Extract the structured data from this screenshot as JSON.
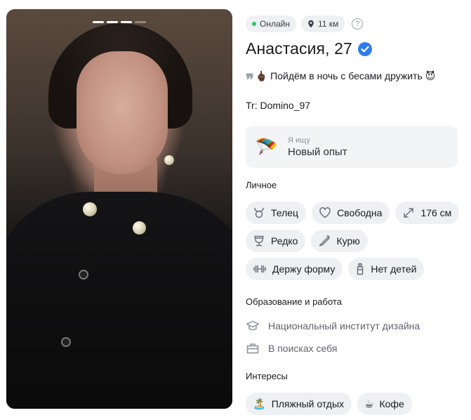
{
  "photo": {
    "pages_total": 4,
    "current_page": 3
  },
  "status": {
    "online_label": "Онлайн",
    "distance": "11 км"
  },
  "profile": {
    "name_age": "Анастасия, 27",
    "verified": true,
    "bio_line1": "🖕🏿 Пойдём в ночь с бесами дружить 😈",
    "bio_line2": "Tr: Domino_97"
  },
  "looking_for": {
    "label": "Я ищу",
    "value": "Новый опыт",
    "icon": "parachute-emoji"
  },
  "personal": {
    "title": "Личное",
    "chips": [
      {
        "icon": "taurus-icon",
        "label": "Телец"
      },
      {
        "icon": "heart-icon",
        "label": "Свободна"
      },
      {
        "icon": "height-icon",
        "label": "176 см"
      },
      {
        "icon": "drink-icon",
        "label": "Редко"
      },
      {
        "icon": "smoking-icon",
        "label": "Курю"
      },
      {
        "icon": "dumbbell-icon",
        "label": "Держу форму"
      },
      {
        "icon": "baby-bottle-icon",
        "label": "Нет детей"
      }
    ]
  },
  "education": {
    "title": "Образование и работа",
    "items": [
      {
        "icon": "graduation-cap-icon",
        "label": "Национальный институт дизайна"
      },
      {
        "icon": "briefcase-icon",
        "label": "В поисках себя"
      }
    ]
  },
  "interests": {
    "title": "Интересы",
    "chips": [
      {
        "emoji": "🏝️",
        "label": "Пляжный отдых"
      },
      {
        "emoji": "☕",
        "label": "Кофе"
      }
    ]
  },
  "colors": {
    "accent": "#2f7cf0",
    "online": "#36c36b",
    "chip_bg": "#eef0f3",
    "photo_bg": "#0d0d0f"
  }
}
